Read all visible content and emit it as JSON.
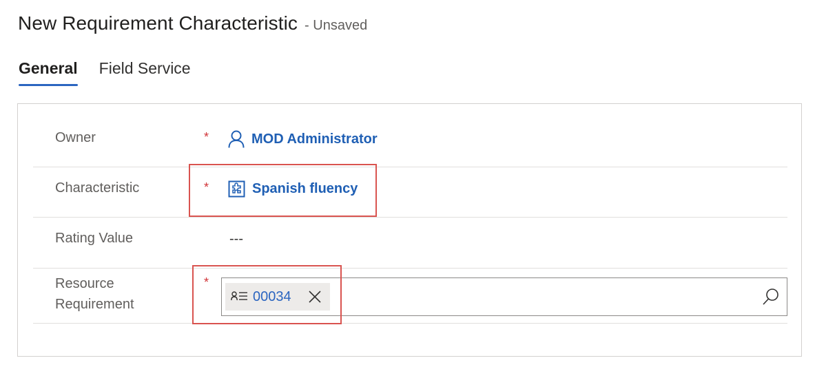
{
  "header": {
    "title": "New Requirement Characteristic",
    "status": "- Unsaved"
  },
  "tabs": [
    {
      "label": "General",
      "active": true
    },
    {
      "label": "Field Service",
      "active": false
    }
  ],
  "form": {
    "required_marker": "*",
    "fields": {
      "owner": {
        "label": "Owner",
        "value": "MOD Administrator",
        "icon": "user-icon"
      },
      "characteristic": {
        "label": "Characteristic",
        "value": "Spanish fluency",
        "icon": "characteristic-icon"
      },
      "rating_value": {
        "label": "Rating Value",
        "value": "---"
      },
      "resource_requirement": {
        "label_line1": "Resource",
        "label_line2": "Requirement",
        "value": "00034",
        "icon": "resource-requirement-icon"
      }
    }
  },
  "colors": {
    "accent": "#2b65c0",
    "link": "#1f5fb4",
    "required": "#d13438",
    "highlight": "#d9534f"
  }
}
